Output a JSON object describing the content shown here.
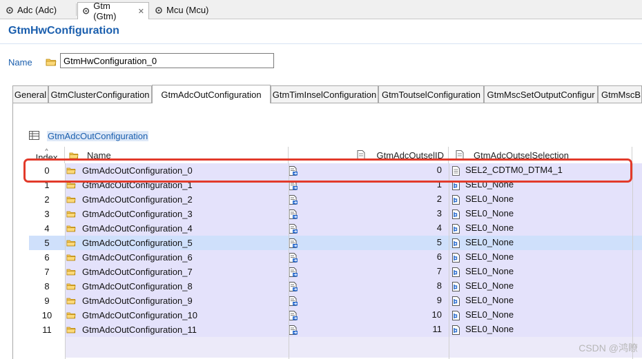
{
  "editor_tabs": [
    {
      "label": "Adc (Adc)",
      "icon": "gear-icon"
    },
    {
      "label": "Gtm (Gtm)",
      "icon": "gear-icon",
      "close": "✕"
    },
    {
      "label": "Mcu (Mcu)",
      "icon": "gear-icon"
    }
  ],
  "page": {
    "title": "GtmHwConfiguration"
  },
  "name_field": {
    "label": "Name",
    "value": "GtmHwConfiguration_0"
  },
  "config_tabs": [
    "General",
    "GtmClusterConfiguration",
    "GtmAdcOutConfiguration",
    "GtmTimInselConfiguration",
    "GtmToutselConfiguration",
    "GtmMscSetOutputConfigur",
    "GtmMscB"
  ],
  "table": {
    "label": "GtmAdcOutConfiguration",
    "columns": {
      "index": "Index",
      "name": "Name",
      "id": "GtmAdcOutselID",
      "sel": "GtmAdcOutselSelection"
    },
    "rows": [
      {
        "index": "0",
        "name": "GtmAdcOutConfiguration_0",
        "id": "0",
        "sel": "SEL2_CDTM0_DTM4_1"
      },
      {
        "index": "1",
        "name": "GtmAdcOutConfiguration_1",
        "id": "1",
        "sel": "SEL0_None"
      },
      {
        "index": "2",
        "name": "GtmAdcOutConfiguration_2",
        "id": "2",
        "sel": "SEL0_None"
      },
      {
        "index": "3",
        "name": "GtmAdcOutConfiguration_3",
        "id": "3",
        "sel": "SEL0_None"
      },
      {
        "index": "4",
        "name": "GtmAdcOutConfiguration_4",
        "id": "4",
        "sel": "SEL0_None"
      },
      {
        "index": "5",
        "name": "GtmAdcOutConfiguration_5",
        "id": "5",
        "sel": "SEL0_None"
      },
      {
        "index": "6",
        "name": "GtmAdcOutConfiguration_6",
        "id": "6",
        "sel": "SEL0_None"
      },
      {
        "index": "7",
        "name": "GtmAdcOutConfiguration_7",
        "id": "7",
        "sel": "SEL0_None"
      },
      {
        "index": "8",
        "name": "GtmAdcOutConfiguration_8",
        "id": "8",
        "sel": "SEL0_None"
      },
      {
        "index": "9",
        "name": "GtmAdcOutConfiguration_9",
        "id": "9",
        "sel": "SEL0_None"
      },
      {
        "index": "10",
        "name": "GtmAdcOutConfiguration_10",
        "id": "10",
        "sel": "SEL0_None"
      },
      {
        "index": "11",
        "name": "GtmAdcOutConfiguration_11",
        "id": "11",
        "sel": "SEL0_None"
      }
    ]
  },
  "watermark": "CSDN @鸿瞭",
  "colors": {
    "accent": "#1b5fae",
    "row_fill": "#e4e2fb",
    "selected_row": "#cfe0fb",
    "highlight": "#e23a2a"
  }
}
